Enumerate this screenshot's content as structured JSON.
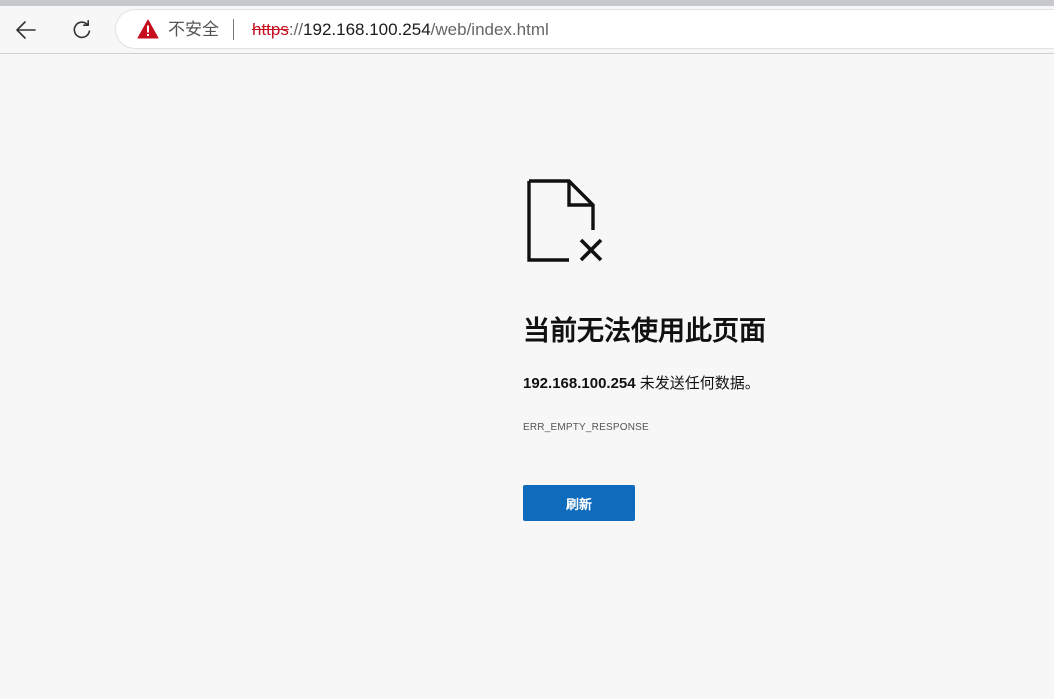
{
  "toolbar": {
    "back_icon": "arrow-left-icon",
    "refresh_icon": "refresh-icon"
  },
  "address": {
    "security_icon": "warning-triangle-icon",
    "security_label": "不安全",
    "separator": "|",
    "scheme": "https",
    "scheme_sep": "://",
    "host": "192.168.100.254",
    "path": "/web/index.html"
  },
  "error": {
    "icon": "file-error-icon",
    "title": "当前无法使用此页面",
    "host": "192.168.100.254",
    "message": " 未发送任何数据。",
    "code": "ERR_EMPTY_RESPONSE",
    "button_label": "刷新"
  },
  "colors": {
    "accent": "#0f6cbd",
    "warning": "#c50f1f",
    "background": "#f7f7f7"
  }
}
